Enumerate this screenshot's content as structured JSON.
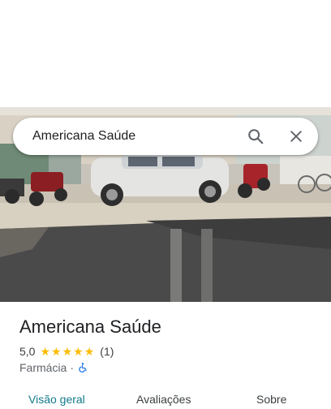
{
  "search": {
    "value": "Americana Saúde"
  },
  "place": {
    "name": "Americana Saúde",
    "rating": "5,0",
    "stars": 5,
    "review_count": "(1)",
    "category": "Farmácia",
    "separator": "·",
    "accessibility_icon": "wheelchair-icon"
  },
  "tabs": [
    {
      "label": "Visão geral",
      "active": true
    },
    {
      "label": "Avaliações",
      "active": false
    },
    {
      "label": "Sobre",
      "active": false
    }
  ],
  "colors": {
    "star": "#fbbc04",
    "active_tab": "#137a8a",
    "accessibility": "#1a73e8"
  }
}
